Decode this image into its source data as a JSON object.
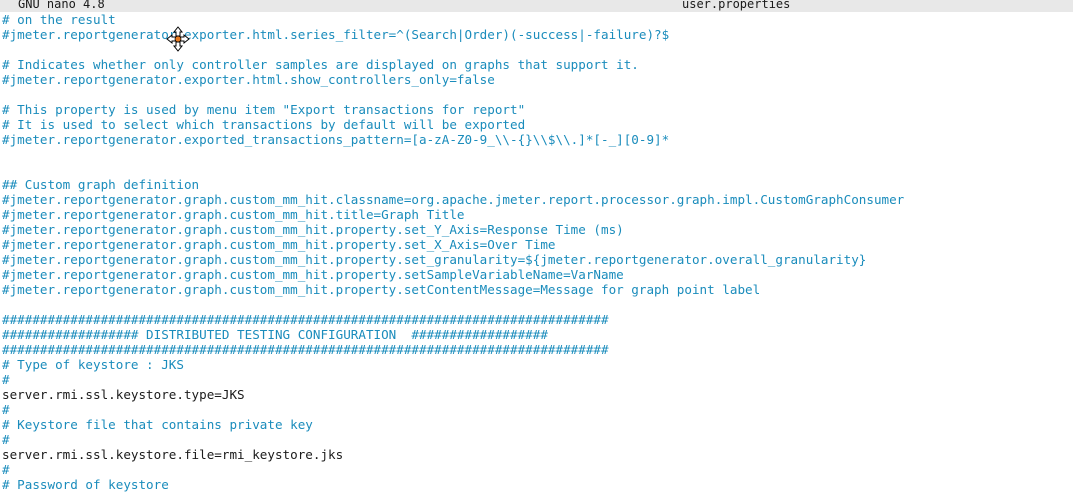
{
  "titlebar": {
    "app": "GNU nano 4.8",
    "file": "user.properties"
  },
  "lines": [
    {
      "text": "# on the result",
      "kind": "c"
    },
    {
      "text": "#jmeter.reportgenerator.exporter.html.series_filter=^(Search|Order)(-success|-failure)?$",
      "kind": "c"
    },
    {
      "text": "",
      "kind": "c"
    },
    {
      "text": "# Indicates whether only controller samples are displayed on graphs that support it.",
      "kind": "c"
    },
    {
      "text": "#jmeter.reportgenerator.exporter.html.show_controllers_only=false",
      "kind": "c"
    },
    {
      "text": "",
      "kind": "c"
    },
    {
      "text": "# This property is used by menu item \"Export transactions for report\"",
      "kind": "c"
    },
    {
      "text": "# It is used to select which transactions by default will be exported",
      "kind": "c"
    },
    {
      "text": "#jmeter.reportgenerator.exported_transactions_pattern=[a-zA-Z0-9_\\\\-{}\\\\$\\\\.]*[-_][0-9]*",
      "kind": "c"
    },
    {
      "text": "",
      "kind": "c"
    },
    {
      "text": "",
      "kind": "c"
    },
    {
      "text": "## Custom graph definition",
      "kind": "c"
    },
    {
      "text": "#jmeter.reportgenerator.graph.custom_mm_hit.classname=org.apache.jmeter.report.processor.graph.impl.CustomGraphConsumer",
      "kind": "c"
    },
    {
      "text": "#jmeter.reportgenerator.graph.custom_mm_hit.title=Graph Title",
      "kind": "c"
    },
    {
      "text": "#jmeter.reportgenerator.graph.custom_mm_hit.property.set_Y_Axis=Response Time (ms)",
      "kind": "c"
    },
    {
      "text": "#jmeter.reportgenerator.graph.custom_mm_hit.property.set_X_Axis=Over Time",
      "kind": "c"
    },
    {
      "text": "#jmeter.reportgenerator.graph.custom_mm_hit.property.set_granularity=${jmeter.reportgenerator.overall_granularity}",
      "kind": "c"
    },
    {
      "text": "#jmeter.reportgenerator.graph.custom_mm_hit.property.setSampleVariableName=VarName",
      "kind": "c"
    },
    {
      "text": "#jmeter.reportgenerator.graph.custom_mm_hit.property.setContentMessage=Message for graph point label",
      "kind": "c"
    },
    {
      "text": "",
      "kind": "c"
    },
    {
      "text": "################################################################################",
      "kind": "c"
    },
    {
      "text": "################## DISTRIBUTED TESTING CONFIGURATION  ##################",
      "kind": "c"
    },
    {
      "text": "################################################################################",
      "kind": "c"
    },
    {
      "text": "# Type of keystore : JKS",
      "kind": "c"
    },
    {
      "text": "#",
      "kind": "c"
    },
    {
      "text": "server.rmi.ssl.keystore.type=JKS",
      "kind": "k"
    },
    {
      "text": "#",
      "kind": "c"
    },
    {
      "text": "# Keystore file that contains private key",
      "kind": "c"
    },
    {
      "text": "#",
      "kind": "c"
    },
    {
      "text": "server.rmi.ssl.keystore.file=rmi_keystore.jks",
      "kind": "k"
    },
    {
      "text": "#",
      "kind": "c"
    },
    {
      "text": "# Password of keystore",
      "kind": "c"
    }
  ],
  "icons": {
    "cursor": "move-cursor-icon"
  }
}
